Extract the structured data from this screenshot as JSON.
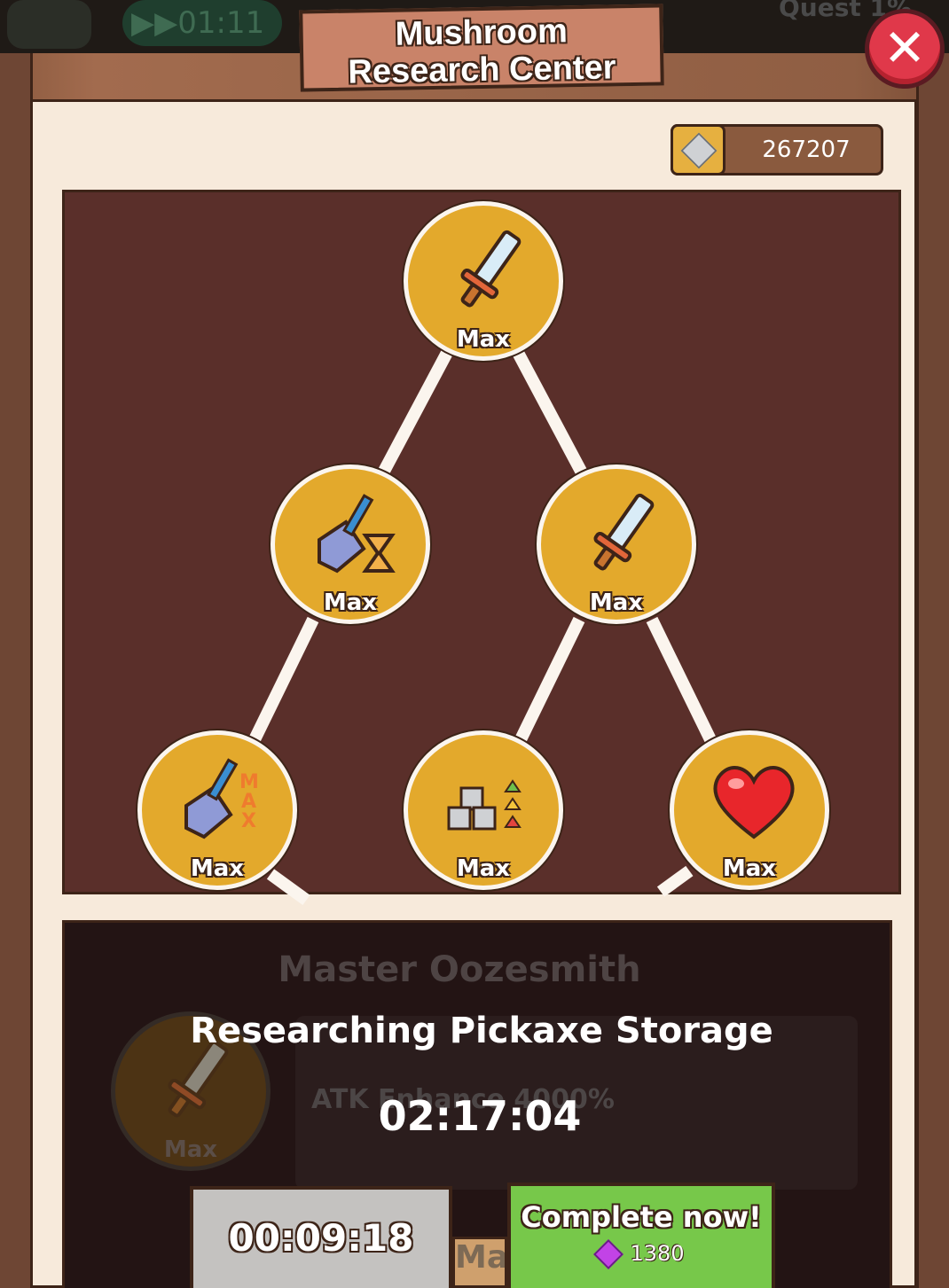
{
  "hud": {
    "timer": "01:11",
    "quest": "Quest 1%"
  },
  "title_line1": "Mushroom",
  "title_line2": "Research Center",
  "close_icon": "✕",
  "resource": {
    "icon": "stone-cube-icon",
    "value": "267207"
  },
  "tree": {
    "nodes": [
      {
        "icon": "sword-icon",
        "label": "Max"
      },
      {
        "icon": "shovel-hourglass-icon",
        "label": "Max"
      },
      {
        "icon": "sword-icon",
        "label": "Max"
      },
      {
        "icon": "shovel-max-icon",
        "label": "Max"
      },
      {
        "icon": "stone-cubes-arrows-icon",
        "label": "Max"
      },
      {
        "icon": "heart-icon",
        "label": "Max"
      }
    ]
  },
  "detail": {
    "title": "Master Oozesmith",
    "node_label": "Max",
    "effect": "ATK Enhance 4000%"
  },
  "research": {
    "title": "Researching Pickaxe Storage",
    "timer": "02:17:04"
  },
  "buttons": {
    "timer_label": "00:09:18",
    "behind_label": "Ma",
    "complete_label": "Complete now!",
    "complete_cost": "1380"
  },
  "colors": {
    "node": "#e3a92c",
    "panel": "#5a2f2a",
    "complete": "#77c84a",
    "close": "#e0384a"
  }
}
